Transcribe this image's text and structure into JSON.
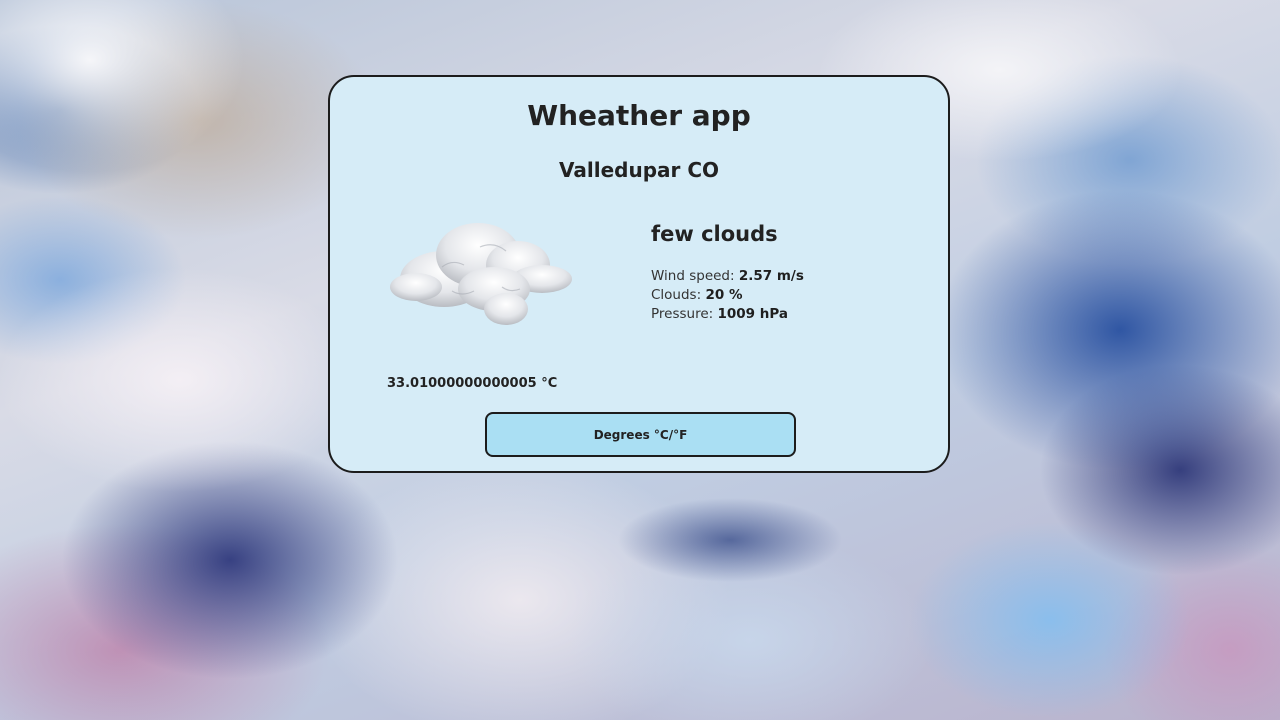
{
  "app": {
    "title": "Wheather app"
  },
  "location": {
    "city": "Valledupar CO"
  },
  "weather": {
    "description": "few clouds",
    "icon": "few-clouds-icon",
    "wind_label": "Wind speed:",
    "wind_value": "2.57 m/s",
    "clouds_label": "Clouds:",
    "clouds_value": "20 %",
    "pressure_label": "Pressure:",
    "pressure_value": "1009 hPa",
    "temperature": "33.01000000000005 °C"
  },
  "controls": {
    "toggle_label": "Degrees °C/°F"
  },
  "colors": {
    "card_background": "#d6ecf7",
    "button_background": "#aadff3",
    "border": "#1c1c1c"
  }
}
